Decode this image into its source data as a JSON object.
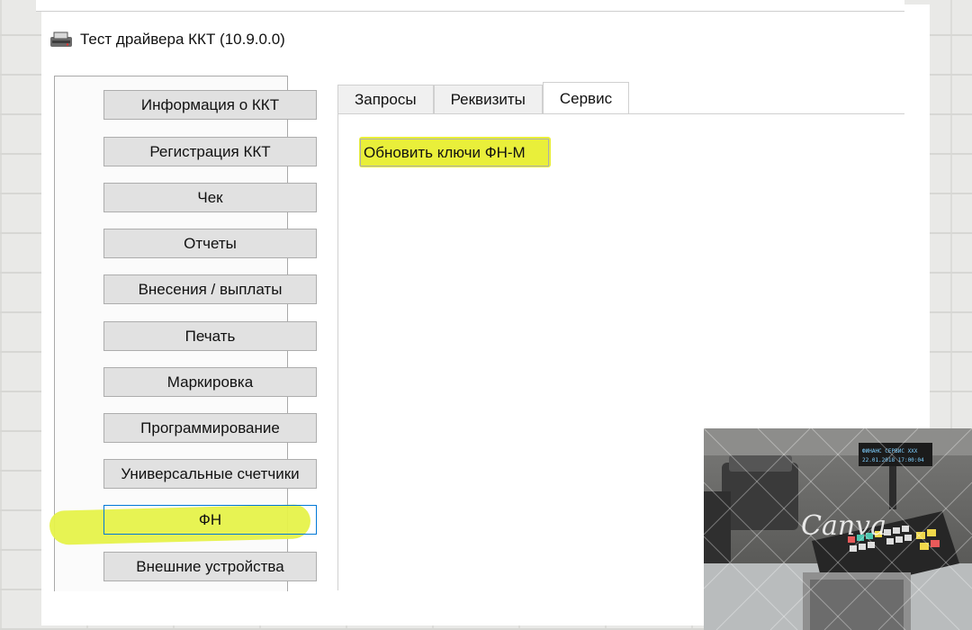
{
  "window": {
    "title": "Тест драйвера ККТ (10.9.0.0)",
    "icon": "printer-icon"
  },
  "sidebar": {
    "items": [
      {
        "label": "Информация о ККТ",
        "active": false
      },
      {
        "label": "Регистрация ККТ",
        "active": false
      },
      {
        "label": "Чек",
        "active": false
      },
      {
        "label": "Отчеты",
        "active": false
      },
      {
        "label": "Внесения / выплаты",
        "active": false
      },
      {
        "label": "Печать",
        "active": false
      },
      {
        "label": "Маркировка",
        "active": false
      },
      {
        "label": "Программирование",
        "active": false
      },
      {
        "label": "Универсальные счетчики",
        "active": false
      },
      {
        "label": "ФН",
        "active": true
      },
      {
        "label": "Внешние устройства",
        "active": false
      }
    ]
  },
  "tabs": [
    {
      "label": "Запросы",
      "active": false
    },
    {
      "label": "Реквизиты",
      "active": false
    },
    {
      "label": "Сервис",
      "active": true
    }
  ],
  "service": {
    "update_keys_label": "Обновить ключи ФН-М"
  },
  "photo": {
    "watermark": "Canva",
    "display_line1": "ФИНАНС СЕРВИС ХХХ",
    "display_line2": "22.01.2018 17:00:04"
  },
  "colors": {
    "highlight": "#e6f24a",
    "active_border": "#0078d7",
    "button_bg": "#e1e1e1"
  }
}
